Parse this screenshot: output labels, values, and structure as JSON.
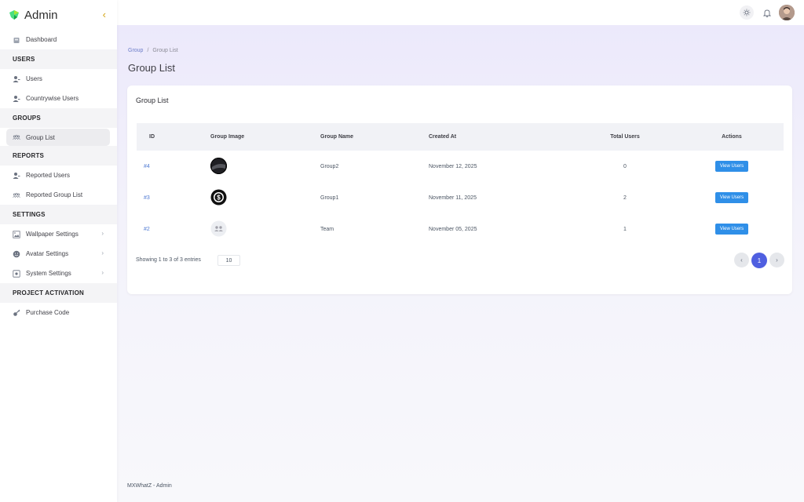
{
  "brand": {
    "title": "Admin",
    "logo_color": "#4ade80"
  },
  "sidebar": {
    "items": [
      {
        "type": "item",
        "label": "Dashboard",
        "icon": "home-icon"
      },
      {
        "type": "section",
        "label": "USERS"
      },
      {
        "type": "item",
        "label": "Users",
        "icon": "user-icon"
      },
      {
        "type": "item",
        "label": "Countrywise Users",
        "icon": "user-icon"
      },
      {
        "type": "section",
        "label": "GROUPS"
      },
      {
        "type": "item",
        "label": "Group List",
        "icon": "group-icon",
        "active": true
      },
      {
        "type": "section",
        "label": "REPORTS"
      },
      {
        "type": "item",
        "label": "Reported Users",
        "icon": "user-icon"
      },
      {
        "type": "item",
        "label": "Reported Group List",
        "icon": "group-icon"
      },
      {
        "type": "section",
        "label": "SETTINGS"
      },
      {
        "type": "item",
        "label": "Wallpaper Settings",
        "icon": "image-icon",
        "chevron": true
      },
      {
        "type": "item",
        "label": "Avatar Settings",
        "icon": "face-icon",
        "chevron": true
      },
      {
        "type": "item",
        "label": "System Settings",
        "icon": "settings-icon",
        "chevron": true
      },
      {
        "type": "section",
        "label": "PROJECT ACTIVATION"
      },
      {
        "type": "item",
        "label": "Purchase Code",
        "icon": "key-icon"
      }
    ]
  },
  "breadcrumb": {
    "parent": "Group",
    "current": "Group List"
  },
  "page_title": "Group List",
  "card": {
    "title": "Group List",
    "columns": {
      "id": "ID",
      "image": "Group Image",
      "name": "Group Name",
      "created": "Created At",
      "total": "Total Users",
      "actions": "Actions"
    },
    "rows": [
      {
        "id": "#4",
        "image": "dark-photo",
        "name": "Group2",
        "created": "November 12, 2025",
        "total": "0",
        "action": "View Users"
      },
      {
        "id": "#3",
        "image": "dollar-logo",
        "name": "Group1",
        "created": "November 11, 2025",
        "total": "2",
        "action": "View Users"
      },
      {
        "id": "#2",
        "image": "group-placeholder",
        "name": "Team",
        "created": "November 05, 2025",
        "total": "1",
        "action": "View Users"
      }
    ],
    "showing": "Showing 1 to 3 of 3 entries",
    "per_page": "10",
    "pagination": {
      "prev": "‹",
      "current": "1",
      "next": "›"
    }
  },
  "footer": "MXWhatZ - Admin",
  "colors": {
    "accent": "#4f5fe0",
    "button": "#2f8fe8",
    "link": "#4f7ad3"
  }
}
